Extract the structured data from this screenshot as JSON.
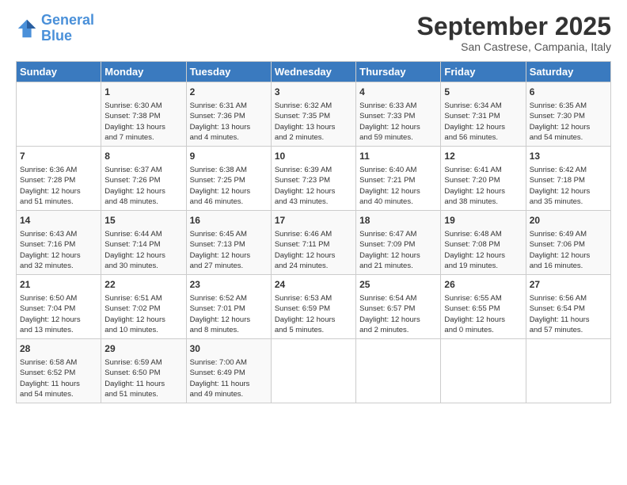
{
  "header": {
    "logo_line1": "General",
    "logo_line2": "Blue",
    "month": "September 2025",
    "location": "San Castrese, Campania, Italy"
  },
  "days_of_week": [
    "Sunday",
    "Monday",
    "Tuesday",
    "Wednesday",
    "Thursday",
    "Friday",
    "Saturday"
  ],
  "weeks": [
    [
      {
        "day": "",
        "info": ""
      },
      {
        "day": "1",
        "info": "Sunrise: 6:30 AM\nSunset: 7:38 PM\nDaylight: 13 hours\nand 7 minutes."
      },
      {
        "day": "2",
        "info": "Sunrise: 6:31 AM\nSunset: 7:36 PM\nDaylight: 13 hours\nand 4 minutes."
      },
      {
        "day": "3",
        "info": "Sunrise: 6:32 AM\nSunset: 7:35 PM\nDaylight: 13 hours\nand 2 minutes."
      },
      {
        "day": "4",
        "info": "Sunrise: 6:33 AM\nSunset: 7:33 PM\nDaylight: 12 hours\nand 59 minutes."
      },
      {
        "day": "5",
        "info": "Sunrise: 6:34 AM\nSunset: 7:31 PM\nDaylight: 12 hours\nand 56 minutes."
      },
      {
        "day": "6",
        "info": "Sunrise: 6:35 AM\nSunset: 7:30 PM\nDaylight: 12 hours\nand 54 minutes."
      }
    ],
    [
      {
        "day": "7",
        "info": "Sunrise: 6:36 AM\nSunset: 7:28 PM\nDaylight: 12 hours\nand 51 minutes."
      },
      {
        "day": "8",
        "info": "Sunrise: 6:37 AM\nSunset: 7:26 PM\nDaylight: 12 hours\nand 48 minutes."
      },
      {
        "day": "9",
        "info": "Sunrise: 6:38 AM\nSunset: 7:25 PM\nDaylight: 12 hours\nand 46 minutes."
      },
      {
        "day": "10",
        "info": "Sunrise: 6:39 AM\nSunset: 7:23 PM\nDaylight: 12 hours\nand 43 minutes."
      },
      {
        "day": "11",
        "info": "Sunrise: 6:40 AM\nSunset: 7:21 PM\nDaylight: 12 hours\nand 40 minutes."
      },
      {
        "day": "12",
        "info": "Sunrise: 6:41 AM\nSunset: 7:20 PM\nDaylight: 12 hours\nand 38 minutes."
      },
      {
        "day": "13",
        "info": "Sunrise: 6:42 AM\nSunset: 7:18 PM\nDaylight: 12 hours\nand 35 minutes."
      }
    ],
    [
      {
        "day": "14",
        "info": "Sunrise: 6:43 AM\nSunset: 7:16 PM\nDaylight: 12 hours\nand 32 minutes."
      },
      {
        "day": "15",
        "info": "Sunrise: 6:44 AM\nSunset: 7:14 PM\nDaylight: 12 hours\nand 30 minutes."
      },
      {
        "day": "16",
        "info": "Sunrise: 6:45 AM\nSunset: 7:13 PM\nDaylight: 12 hours\nand 27 minutes."
      },
      {
        "day": "17",
        "info": "Sunrise: 6:46 AM\nSunset: 7:11 PM\nDaylight: 12 hours\nand 24 minutes."
      },
      {
        "day": "18",
        "info": "Sunrise: 6:47 AM\nSunset: 7:09 PM\nDaylight: 12 hours\nand 21 minutes."
      },
      {
        "day": "19",
        "info": "Sunrise: 6:48 AM\nSunset: 7:08 PM\nDaylight: 12 hours\nand 19 minutes."
      },
      {
        "day": "20",
        "info": "Sunrise: 6:49 AM\nSunset: 7:06 PM\nDaylight: 12 hours\nand 16 minutes."
      }
    ],
    [
      {
        "day": "21",
        "info": "Sunrise: 6:50 AM\nSunset: 7:04 PM\nDaylight: 12 hours\nand 13 minutes."
      },
      {
        "day": "22",
        "info": "Sunrise: 6:51 AM\nSunset: 7:02 PM\nDaylight: 12 hours\nand 10 minutes."
      },
      {
        "day": "23",
        "info": "Sunrise: 6:52 AM\nSunset: 7:01 PM\nDaylight: 12 hours\nand 8 minutes."
      },
      {
        "day": "24",
        "info": "Sunrise: 6:53 AM\nSunset: 6:59 PM\nDaylight: 12 hours\nand 5 minutes."
      },
      {
        "day": "25",
        "info": "Sunrise: 6:54 AM\nSunset: 6:57 PM\nDaylight: 12 hours\nand 2 minutes."
      },
      {
        "day": "26",
        "info": "Sunrise: 6:55 AM\nSunset: 6:55 PM\nDaylight: 12 hours\nand 0 minutes."
      },
      {
        "day": "27",
        "info": "Sunrise: 6:56 AM\nSunset: 6:54 PM\nDaylight: 11 hours\nand 57 minutes."
      }
    ],
    [
      {
        "day": "28",
        "info": "Sunrise: 6:58 AM\nSunset: 6:52 PM\nDaylight: 11 hours\nand 54 minutes."
      },
      {
        "day": "29",
        "info": "Sunrise: 6:59 AM\nSunset: 6:50 PM\nDaylight: 11 hours\nand 51 minutes."
      },
      {
        "day": "30",
        "info": "Sunrise: 7:00 AM\nSunset: 6:49 PM\nDaylight: 11 hours\nand 49 minutes."
      },
      {
        "day": "",
        "info": ""
      },
      {
        "day": "",
        "info": ""
      },
      {
        "day": "",
        "info": ""
      },
      {
        "day": "",
        "info": ""
      }
    ]
  ]
}
